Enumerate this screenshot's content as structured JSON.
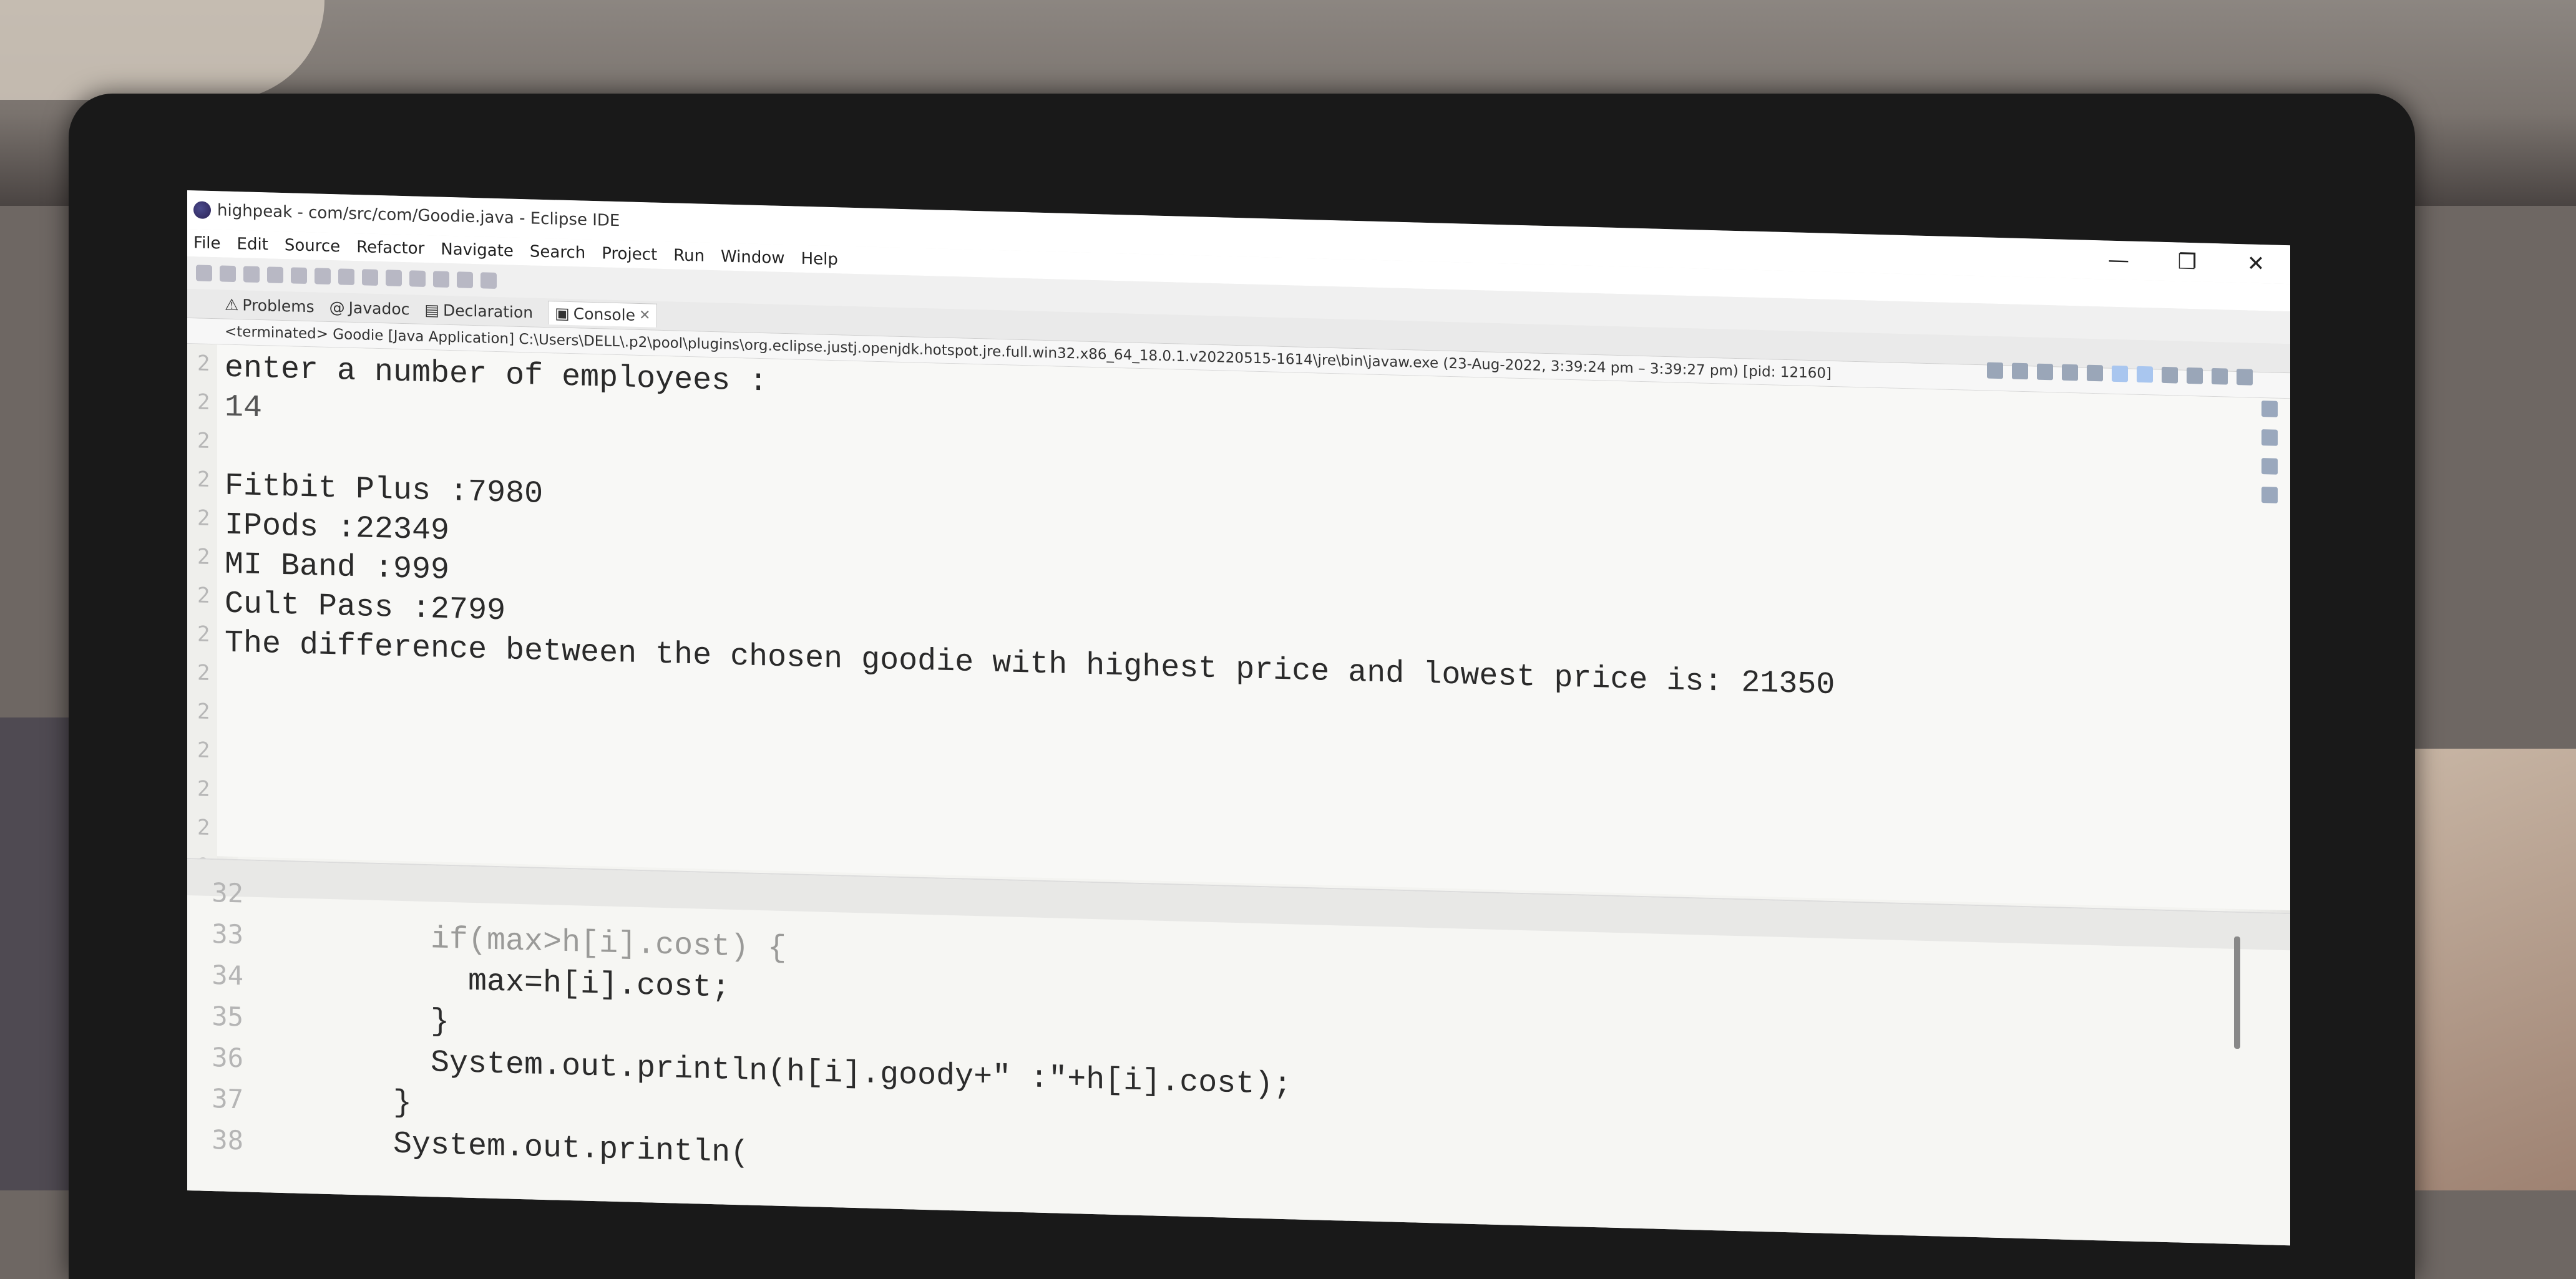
{
  "window": {
    "title": "highpeak - com/src/com/Goodie.java - Eclipse IDE",
    "controls": [
      "—",
      "❐",
      "✕"
    ]
  },
  "menu": [
    "File",
    "Edit",
    "Source",
    "Refactor",
    "Navigate",
    "Search",
    "Project",
    "Run",
    "Window",
    "Help"
  ],
  "tabs": [
    {
      "label": "Problems",
      "icon": "problems-icon"
    },
    {
      "label": "Javadoc",
      "icon": "javadoc-icon"
    },
    {
      "label": "Declaration",
      "icon": "declaration-icon"
    },
    {
      "label": "Console",
      "icon": "console-icon",
      "active": true
    }
  ],
  "launch_info": "<terminated> Goodie [Java Application] C:\\Users\\DELL\\.p2\\pool\\plugins\\org.eclipse.justj.openjdk.hotspot.jre.full.win32.x86_64_18.0.1.v20220515-1614\\jre\\bin\\javaw.exe (23-Aug-2022, 3:39:24 pm – 3:39:27 pm) [pid: 12160]",
  "console_output": [
    "enter a number of employees :",
    "14",
    "",
    "Fitbit Plus :7980",
    "IPods :22349",
    "MI Band :999",
    "Cult Pass :2799",
    "The difference between the chosen goodie with highest price and lowest price is: 21350"
  ],
  "editor": {
    "line_numbers": [
      "32",
      "33",
      "34",
      "35",
      "36",
      "37",
      "38"
    ],
    "lines": [
      "",
      "      if(max>h[i].cost) {",
      "        max=h[i].cost;",
      "      }",
      "      System.out.println(h[i].goody+\" :\"+h[i].cost);",
      "    }",
      "    System.out.println("
    ]
  }
}
